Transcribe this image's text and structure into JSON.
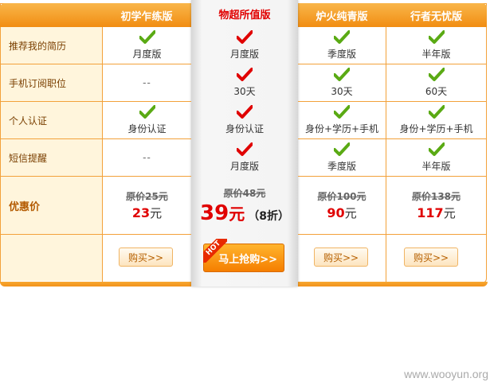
{
  "plans": [
    {
      "name": "初学乍练版",
      "featured": false
    },
    {
      "name": "物超所值版",
      "featured": true
    },
    {
      "name": "炉火纯青版",
      "featured": false
    },
    {
      "name": "行者无忧版",
      "featured": false
    }
  ],
  "rows": [
    {
      "label": "推荐我的简历",
      "cells": [
        {
          "check": true,
          "text": "月度版"
        },
        {
          "check": true,
          "text": "月度版"
        },
        {
          "check": true,
          "text": "季度版"
        },
        {
          "check": true,
          "text": "半年版"
        }
      ]
    },
    {
      "label": "手机订阅职位",
      "cells": [
        {
          "check": false,
          "text": "--"
        },
        {
          "check": true,
          "text": "30天"
        },
        {
          "check": true,
          "text": "30天"
        },
        {
          "check": true,
          "text": "60天"
        }
      ]
    },
    {
      "label": "个人认证",
      "cells": [
        {
          "check": true,
          "text": "身份认证"
        },
        {
          "check": true,
          "text": "身份认证"
        },
        {
          "check": true,
          "text": "身份+学历+手机"
        },
        {
          "check": true,
          "text": "身份+学历+手机"
        }
      ]
    },
    {
      "label": "短信提醒",
      "cells": [
        {
          "check": false,
          "text": "--"
        },
        {
          "check": true,
          "text": "月度版"
        },
        {
          "check": true,
          "text": "季度版"
        },
        {
          "check": true,
          "text": "半年版"
        }
      ]
    }
  ],
  "price_row": {
    "label": "优惠价",
    "cells": [
      {
        "original": "原价25元",
        "price": "23",
        "unit": "元"
      },
      {
        "original": "原价48元",
        "price": "39",
        "unit": "元",
        "discount": "（8折）"
      },
      {
        "original": "原价100元",
        "price": "90",
        "unit": "元"
      },
      {
        "original": "原价138元",
        "price": "117",
        "unit": "元"
      }
    ]
  },
  "buttons": {
    "buy_label": "购买>>",
    "hot_badge": "HOT",
    "hot_label": "马上抢购>>"
  },
  "colors": {
    "accent_orange": "#f18d12",
    "check_green": "#5aaa14",
    "check_red": "#e00000",
    "price_red": "#e00000"
  },
  "watermark": "www.wooyun.org"
}
